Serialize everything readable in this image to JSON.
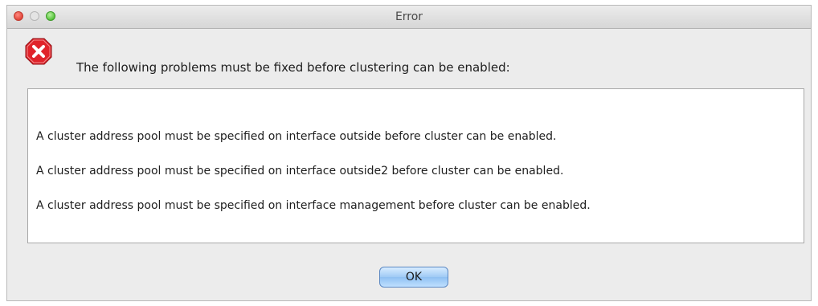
{
  "window": {
    "title": "Error"
  },
  "icons": {
    "error": "error-stop-icon",
    "error_color": "#e0232a"
  },
  "dialog": {
    "header": "The following problems must be fixed before clustering can be enabled:",
    "messages": [
      "A cluster address pool must be specified on interface outside before cluster can be enabled.",
      "A cluster address pool must be specified on interface outside2 before cluster can be enabled.",
      "A cluster address pool must be specified on interface management before cluster can be enabled."
    ],
    "ok_label": "OK"
  }
}
